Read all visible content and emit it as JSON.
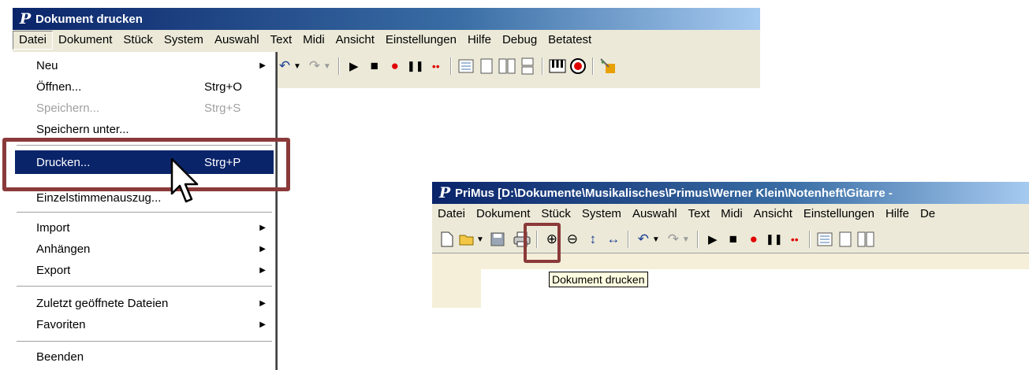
{
  "window1": {
    "title": "Dokument drucken",
    "menubar": [
      "Datei",
      "Dokument",
      "Stück",
      "System",
      "Auswahl",
      "Text",
      "Midi",
      "Ansicht",
      "Einstellungen",
      "Hilfe",
      "Debug",
      "Betatest"
    ]
  },
  "file_menu": {
    "items": [
      {
        "label": "Neu",
        "shortcut": "",
        "submenu": true,
        "disabled": false
      },
      {
        "label": "Öffnen...",
        "shortcut": "Strg+O",
        "submenu": false,
        "disabled": false
      },
      {
        "label": "Speichern...",
        "shortcut": "Strg+S",
        "submenu": false,
        "disabled": true
      },
      {
        "label": "Speichern unter...",
        "shortcut": "",
        "submenu": false,
        "disabled": false
      },
      {
        "label": "Drucken...",
        "shortcut": "Strg+P",
        "submenu": false,
        "disabled": false,
        "selected": true
      },
      {
        "label": "Einzelstimmenauszug...",
        "shortcut": "",
        "submenu": false,
        "disabled": false
      },
      {
        "label": "Import",
        "shortcut": "",
        "submenu": true,
        "disabled": false
      },
      {
        "label": "Anhängen",
        "shortcut": "",
        "submenu": true,
        "disabled": false
      },
      {
        "label": "Export",
        "shortcut": "",
        "submenu": true,
        "disabled": false
      },
      {
        "label": "Zuletzt geöffnete Dateien",
        "shortcut": "",
        "submenu": true,
        "disabled": false
      },
      {
        "label": "Favoriten",
        "shortcut": "",
        "submenu": true,
        "disabled": false
      },
      {
        "label": "Beenden",
        "shortcut": "",
        "submenu": false,
        "disabled": false
      }
    ]
  },
  "window2": {
    "title": "PriMus [D:\\Dokumente\\Musikalisches\\Primus\\Werner Klein\\Notenheft\\Gitarre -",
    "menubar": [
      "Datei",
      "Dokument",
      "Stück",
      "System",
      "Auswahl",
      "Text",
      "Midi",
      "Ansicht",
      "Einstellungen",
      "Hilfe",
      "De"
    ],
    "tooltip": "Dokument drucken"
  },
  "colors": {
    "highlight": "#0a246a",
    "callout": "#8b3a3a",
    "tooltip_bg": "#ffffe1",
    "canvas": "#f5efd9"
  },
  "icons": {
    "logo": "P",
    "submenu_arrow": "▶",
    "undo": "↶",
    "redo": "↷",
    "play": "▶",
    "stop": "■",
    "record": "●",
    "pause": "❚❚",
    "rec2": "••",
    "new": "🗋",
    "open": "📂",
    "save": "💾",
    "print": "🖶",
    "zoom_in": "⊕",
    "zoom_out": "⊖",
    "fit_height": "↕",
    "fit_width": "↔",
    "piano": "▥",
    "metronome": "◉",
    "wizard": "✦"
  }
}
